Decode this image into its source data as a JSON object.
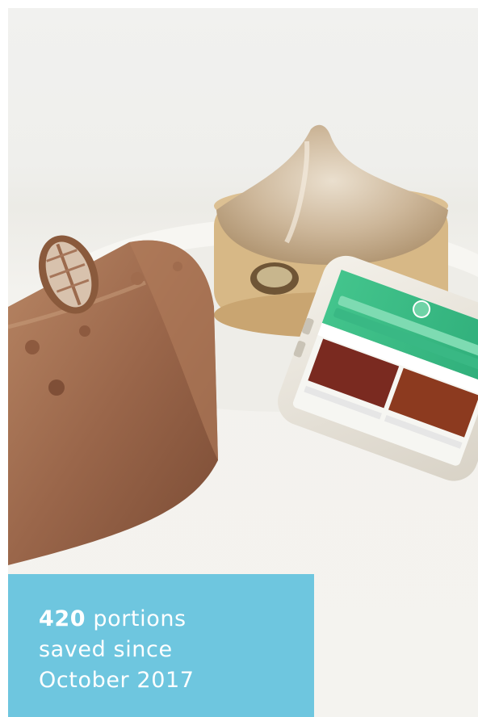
{
  "hero": {
    "image_label": "photo-of-desserts-and-phone"
  },
  "stat": {
    "number": "420",
    "line1_rest": " portions",
    "line2": "saved since",
    "line3": "October 2017",
    "background_color": "#6ec6df",
    "text_color": "#ffffff"
  }
}
